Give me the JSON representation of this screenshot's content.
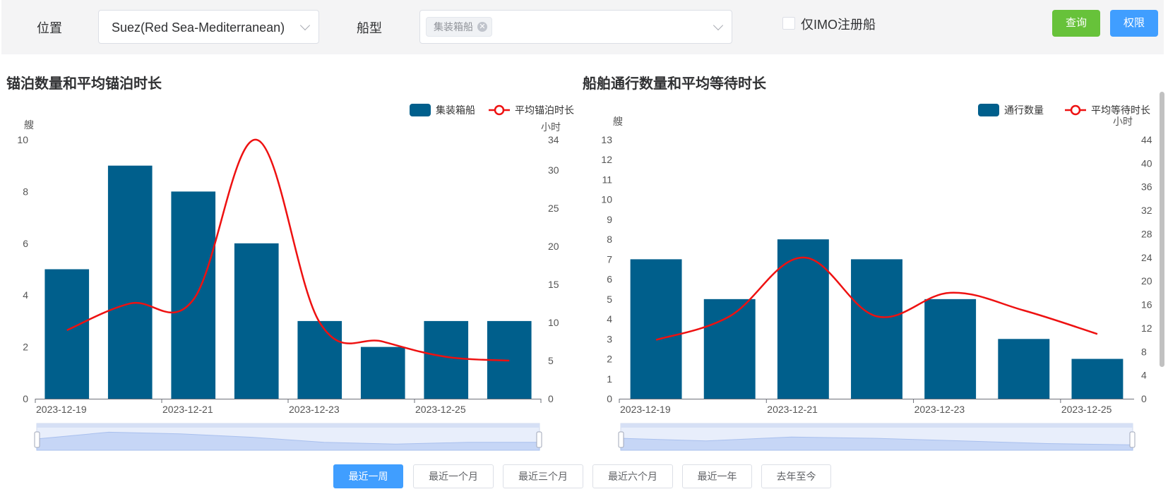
{
  "filters": {
    "location_label": "位置",
    "location_value": "Suez(Red Sea-Mediterranean)",
    "ship_type_label": "船型",
    "ship_type_tag": "集装箱船",
    "imo_only_label": "仅IMO注册船",
    "query_button": "查询",
    "permission_button": "权限"
  },
  "colors": {
    "bar": "#005f8c",
    "line": "#ee1111",
    "query": "#67c23a",
    "primary": "#409eff"
  },
  "chart_data": [
    {
      "type": "bar",
      "title": "锚泊数量和平均锚泊时长",
      "categories": [
        "2023-12-19",
        "2023-12-20",
        "2023-12-21",
        "2023-12-22",
        "2023-12-23",
        "2023-12-24",
        "2023-12-25",
        "2023-12-26"
      ],
      "x_tick_labels": [
        "2023-12-19",
        "2023-12-21",
        "2023-12-23",
        "2023-12-25"
      ],
      "series": [
        {
          "name": "集装箱船",
          "type": "bar",
          "axis": "left",
          "values": [
            5,
            9,
            8,
            6,
            3,
            2,
            3,
            3
          ]
        },
        {
          "name": "平均锚泊时长",
          "type": "line",
          "axis": "right",
          "smooth": true,
          "values": [
            9,
            12.5,
            13,
            34,
            10,
            7.5,
            5.5,
            5
          ]
        }
      ],
      "ylabel_left": "艘",
      "ylabel_right": "小时",
      "ylim_left": [
        0,
        10
      ],
      "yticks_left": [
        0,
        2,
        4,
        6,
        8,
        10
      ],
      "ylim_right": [
        0,
        34
      ],
      "yticks_right": [
        0,
        5,
        10,
        15,
        20,
        25,
        30,
        34
      ],
      "legend": "top-right"
    },
    {
      "type": "bar",
      "title": "船舶通行数量和平均等待时长",
      "categories": [
        "2023-12-19",
        "2023-12-20",
        "2023-12-21",
        "2023-12-22",
        "2023-12-23",
        "2023-12-24",
        "2023-12-25"
      ],
      "x_tick_labels": [
        "2023-12-19",
        "2023-12-21",
        "2023-12-23",
        "2023-12-25"
      ],
      "series": [
        {
          "name": "通行数量",
          "type": "bar",
          "axis": "left",
          "values": [
            7,
            5,
            8,
            7,
            5,
            3,
            2
          ]
        },
        {
          "name": "平均等待时长",
          "type": "line",
          "axis": "right",
          "smooth": true,
          "values": [
            10,
            14,
            24,
            14,
            18,
            15,
            11
          ]
        }
      ],
      "ylabel_left": "艘",
      "ylabel_right": "小时",
      "ylim_left": [
        0,
        13
      ],
      "yticks_left": [
        0,
        1,
        2,
        3,
        4,
        5,
        6,
        7,
        8,
        9,
        10,
        11,
        12,
        13
      ],
      "ylim_right": [
        0,
        44
      ],
      "yticks_right": [
        0,
        4,
        8,
        12,
        16,
        20,
        24,
        28,
        32,
        36,
        40,
        44
      ],
      "legend": "top-right"
    }
  ],
  "range_buttons": [
    "最近一周",
    "最近一个月",
    "最近三个月",
    "最近六个月",
    "最近一年",
    "去年至今"
  ],
  "active_range": "最近一周"
}
